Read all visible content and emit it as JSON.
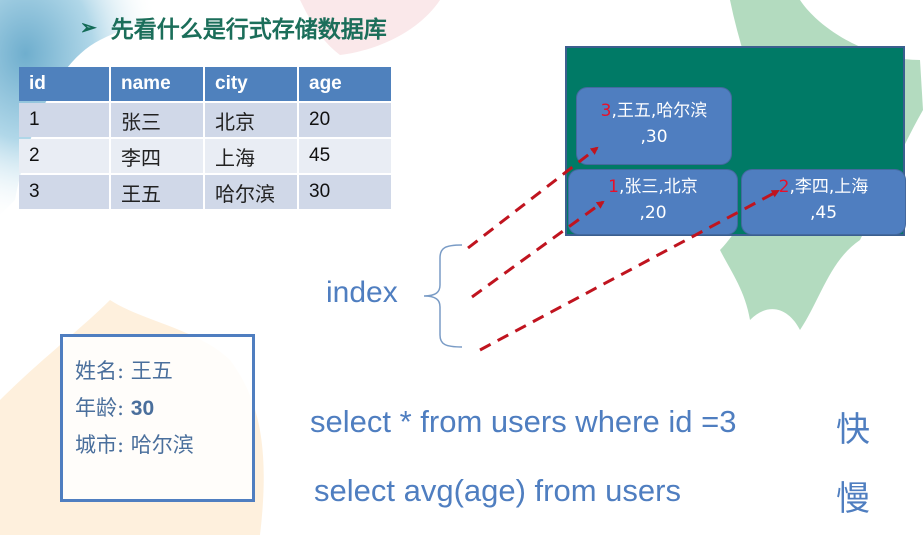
{
  "slide": {
    "title": "先看什么是行式存储数据库",
    "bullet_icon": "arrow-bullet-icon"
  },
  "table": {
    "headers": [
      "id",
      "name",
      "city",
      "age"
    ],
    "rows": [
      [
        "1",
        "张三",
        "北京",
        "20"
      ],
      [
        "2",
        "李四",
        "上海",
        "45"
      ],
      [
        "3",
        "王五",
        "哈尔滨",
        "30"
      ]
    ]
  },
  "storage_blocks": [
    {
      "id": "3",
      "rest_line1": ",王五,哈尔滨",
      "rest_line2": ",30"
    },
    {
      "id": "1",
      "rest_line1": ",张三,北京",
      "rest_line2": ",20"
    },
    {
      "id": "2",
      "rest_line1": ",李四,上海",
      "rest_line2": ",45"
    }
  ],
  "index": {
    "label": "index"
  },
  "record": {
    "lines": [
      {
        "key": "姓名: ",
        "value": "王五"
      },
      {
        "key": "年龄: ",
        "value": "30"
      },
      {
        "key": "城市: ",
        "value": "哈尔滨"
      }
    ]
  },
  "queries": [
    {
      "sql": "select * from users where id =3",
      "speed": "快"
    },
    {
      "sql": "select avg(age) from users",
      "speed": "慢"
    }
  ],
  "colors": {
    "title": "#1b6e5a",
    "table_header": "#4f81bd",
    "storage_bg": "#007a66",
    "block": "#4f7ec0",
    "id_highlight": "#e8102a",
    "arrow": "#c0141f",
    "text_blue": "#4f7ec0"
  }
}
